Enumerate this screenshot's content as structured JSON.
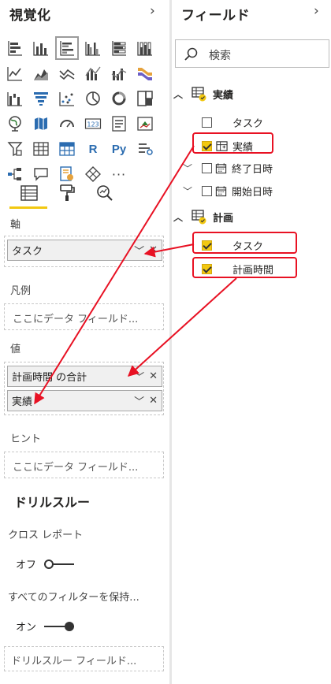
{
  "viz_panel": {
    "title": "視覚化",
    "collapse_glyph": "›",
    "gallery": [
      "stacked-bar-icon",
      "stacked-column-icon",
      "clustered-bar-icon",
      "clustered-column-icon",
      "100-bar-icon",
      "100-column-icon",
      "line-chart-icon",
      "area-chart-icon",
      "stacked-area-icon",
      "line-column-icon",
      "line-column-2-icon",
      "ribbon-chart-icon",
      "waterfall-icon",
      "funnel-icon",
      "scatter-icon",
      "pie-icon",
      "donut-icon",
      "treemap-icon",
      "map-icon",
      "filled-map-icon",
      "gauge-icon",
      "card-icon",
      "multirow-card-icon",
      "kpi-icon",
      "slicer-icon",
      "table-icon",
      "matrix-icon",
      "r-visual-icon",
      "python-visual-icon",
      "key-influencers-icon",
      "decomposition-tree-icon",
      "qna-icon",
      "paginated-icon",
      "powerapps-icon",
      "more-icon"
    ],
    "gallery_text": {
      "card": "123",
      "r": "R",
      "py": "Py",
      "more": "···"
    },
    "tabs": [
      "fields-tab-icon",
      "format-tab-icon",
      "analytics-tab-icon"
    ],
    "axis_label": "軸",
    "axis_field": "タスク",
    "legend_label": "凡例",
    "legend_placeholder": "ここにデータ フィールド...",
    "values_label": "値",
    "values_fields": [
      "計画時間 の合計",
      "実績"
    ],
    "tooltips_label": "ヒント",
    "tooltips_placeholder": "ここにデータ フィールド...",
    "drill_title": "ドリルスルー",
    "cross_report_label": "クロス レポート",
    "cross_report_state": "オフ",
    "keep_filters_label": "すべてのフィルターを保持...",
    "keep_filters_state": "オン",
    "drill_placeholder": "ドリルスルー フィールド...",
    "chip_chevron": "﹀",
    "chip_remove": "✕"
  },
  "fields_panel": {
    "title": "フィールド",
    "collapse_glyph": "›",
    "search_placeholder": "検索",
    "tables": [
      {
        "name": "実績",
        "fields": [
          {
            "label": "タスク",
            "checked": false
          },
          {
            "label": "実績",
            "checked": true
          },
          {
            "label": "終了日時",
            "checked": false
          },
          {
            "label": "開始日時",
            "checked": false
          }
        ]
      },
      {
        "name": "計画",
        "fields": [
          {
            "label": "タスク",
            "checked": true
          },
          {
            "label": "計画時間",
            "checked": true
          }
        ]
      }
    ],
    "expanded_glyph": "︿",
    "collapsed_glyph": "﹀"
  },
  "colors": {
    "accent": "#f2c811",
    "annotation": "#e81123"
  }
}
